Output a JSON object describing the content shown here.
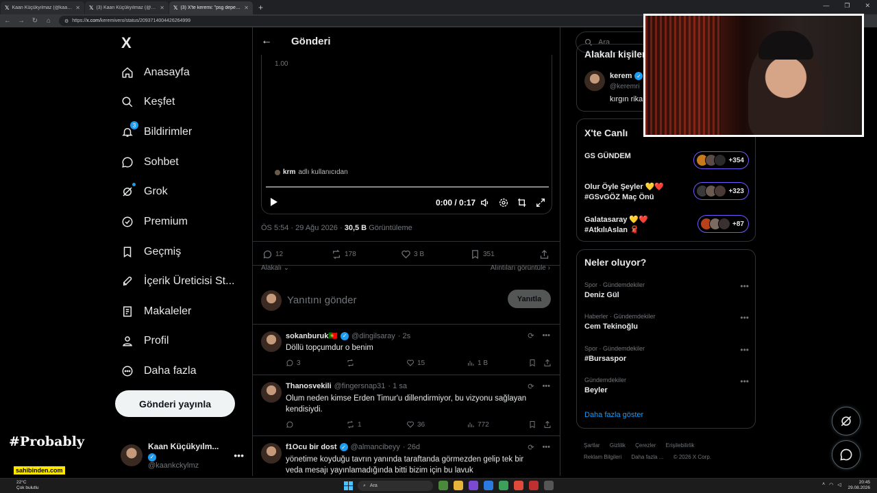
{
  "browser": {
    "tabs": [
      {
        "title": "Kaan Küçükyılmaz (@kaankckylm",
        "active": false
      },
      {
        "title": "(3) Kaan Küçükyılmaz (@kaankcky",
        "active": false
      },
      {
        "title": "(3) X'te keremi: \"psg depe ömer ba",
        "active": true
      }
    ],
    "new_tab": "+",
    "url_prefix": "https://",
    "url_domain": "x.com",
    "url_path": "/keremivero/status/2093714004426264999"
  },
  "nav": {
    "logo": "X",
    "items": [
      {
        "label": "Anasayfa",
        "icon": "home-icon"
      },
      {
        "label": "Keşfet",
        "icon": "search-icon"
      },
      {
        "label": "Bildirimler",
        "icon": "bell-icon",
        "badge": "3"
      },
      {
        "label": "Sohbet",
        "icon": "chat-icon"
      },
      {
        "label": "Grok",
        "icon": "grok-icon"
      },
      {
        "label": "Premium",
        "icon": "premium-icon"
      },
      {
        "label": "Geçmiş",
        "icon": "bookmark-icon"
      },
      {
        "label": "İçerik Üreticisi St...",
        "icon": "rocket-icon"
      },
      {
        "label": "Makaleler",
        "icon": "articles-icon"
      },
      {
        "label": "Profil",
        "icon": "profile-icon"
      },
      {
        "label": "Daha fazla",
        "icon": "more-icon"
      }
    ],
    "post_button": "Gönderi yayınla",
    "account": {
      "name": "Kaan Küçükyılm...",
      "handle": "@kaankckylmz"
    }
  },
  "overlay": {
    "brand_text": "#Probably",
    "sponsor": "sahibinden.com"
  },
  "post": {
    "header_title": "Gönderi",
    "video": {
      "quality_label": "1.00",
      "source_user": "krm",
      "source_suffix": "adlı kullanıcıdan",
      "time": "0:00 / 0:17",
      "progress": 0.0
    },
    "time": "ÖS 5:54 · 29 Ağu 2026 · ",
    "views_count": "30,5 B",
    "views_label": "Görüntüleme",
    "stats": {
      "replies": "12",
      "reposts": "178",
      "likes": "3 B",
      "bookmarks": "351"
    },
    "sort_label": "Alakalı",
    "quotes_link": "Alıntıları görüntüle",
    "reply_placeholder": "Yanıtını gönder",
    "reply_button": "Yanıtla"
  },
  "comments": [
    {
      "name": "sokanburuk🇵🇹",
      "handle": "@dingilsaray",
      "time": "· 2s",
      "text": "Döllü topçumdur o benim",
      "replies": "3",
      "reposts": "",
      "likes": "15",
      "views": "1 B"
    },
    {
      "name": "Thanosvekili",
      "handle": "@fingersnap31",
      "time": "· 1 sa",
      "text": "Olum neden kimse Erden Timur'u dillendirmiyor, bu vizyonu sağlayan kendisiydi.",
      "replies": "",
      "reposts": "1",
      "likes": "36",
      "views": "772"
    },
    {
      "name": "f1Ocu bir dost",
      "handle": "@almancibeyy",
      "time": "· 26d",
      "text": "yönetime koyduğu tavrın yanında taraftanda görmezden gelip tek bir veda mesajı yayınlamadığında bitti bizim için bu lavuk"
    }
  ],
  "sidebar": {
    "search_placeholder": "Ara",
    "relevant_title": "Alakalı kişiler",
    "relevant_person": {
      "name": "kerem",
      "handle": "@keremri",
      "bio": "kırgın rika"
    },
    "live_title": "X'te Canlı",
    "live": [
      {
        "title": "GS GÜNDEM",
        "count": "+354"
      },
      {
        "title": "Olur Öyle Şeyler 💛❤️ #GSvGÖZ Maç Önü",
        "count": "+323"
      },
      {
        "title": "Galatasaray 💛❤️ #AtkılıAslan 🧣",
        "count": "+87"
      }
    ],
    "trends_title": "Neler oluyor?",
    "trends": [
      {
        "category": "Spor · Gündemdekiler",
        "name": "Deniz Gül"
      },
      {
        "category": "Haberler · Gündemdekiler",
        "name": "Cem Tekinoğlu"
      },
      {
        "category": "Spor · Gündemdekiler",
        "name": "#Bursaspor"
      },
      {
        "category": "Gündemdekiler",
        "name": "Beyler"
      }
    ],
    "show_more": "Daha fazla göster",
    "footer_row1": [
      "Şartlar",
      "Gizlilik",
      "Çerezler",
      "Erişilebilirlik"
    ],
    "footer_row2": [
      "Reklam Bilgileri",
      "Daha fazla ...",
      "© 2026 X Corp."
    ]
  },
  "taskbar": {
    "temp": "22°C",
    "weather": "Çok bulutlu",
    "search": "Ara",
    "clock": "20:45",
    "date": "29.08.2026"
  },
  "colors": {
    "accent": "#1d9bf0",
    "live_border": "#7856ff",
    "background": "#000000",
    "muted": "#71767b"
  }
}
